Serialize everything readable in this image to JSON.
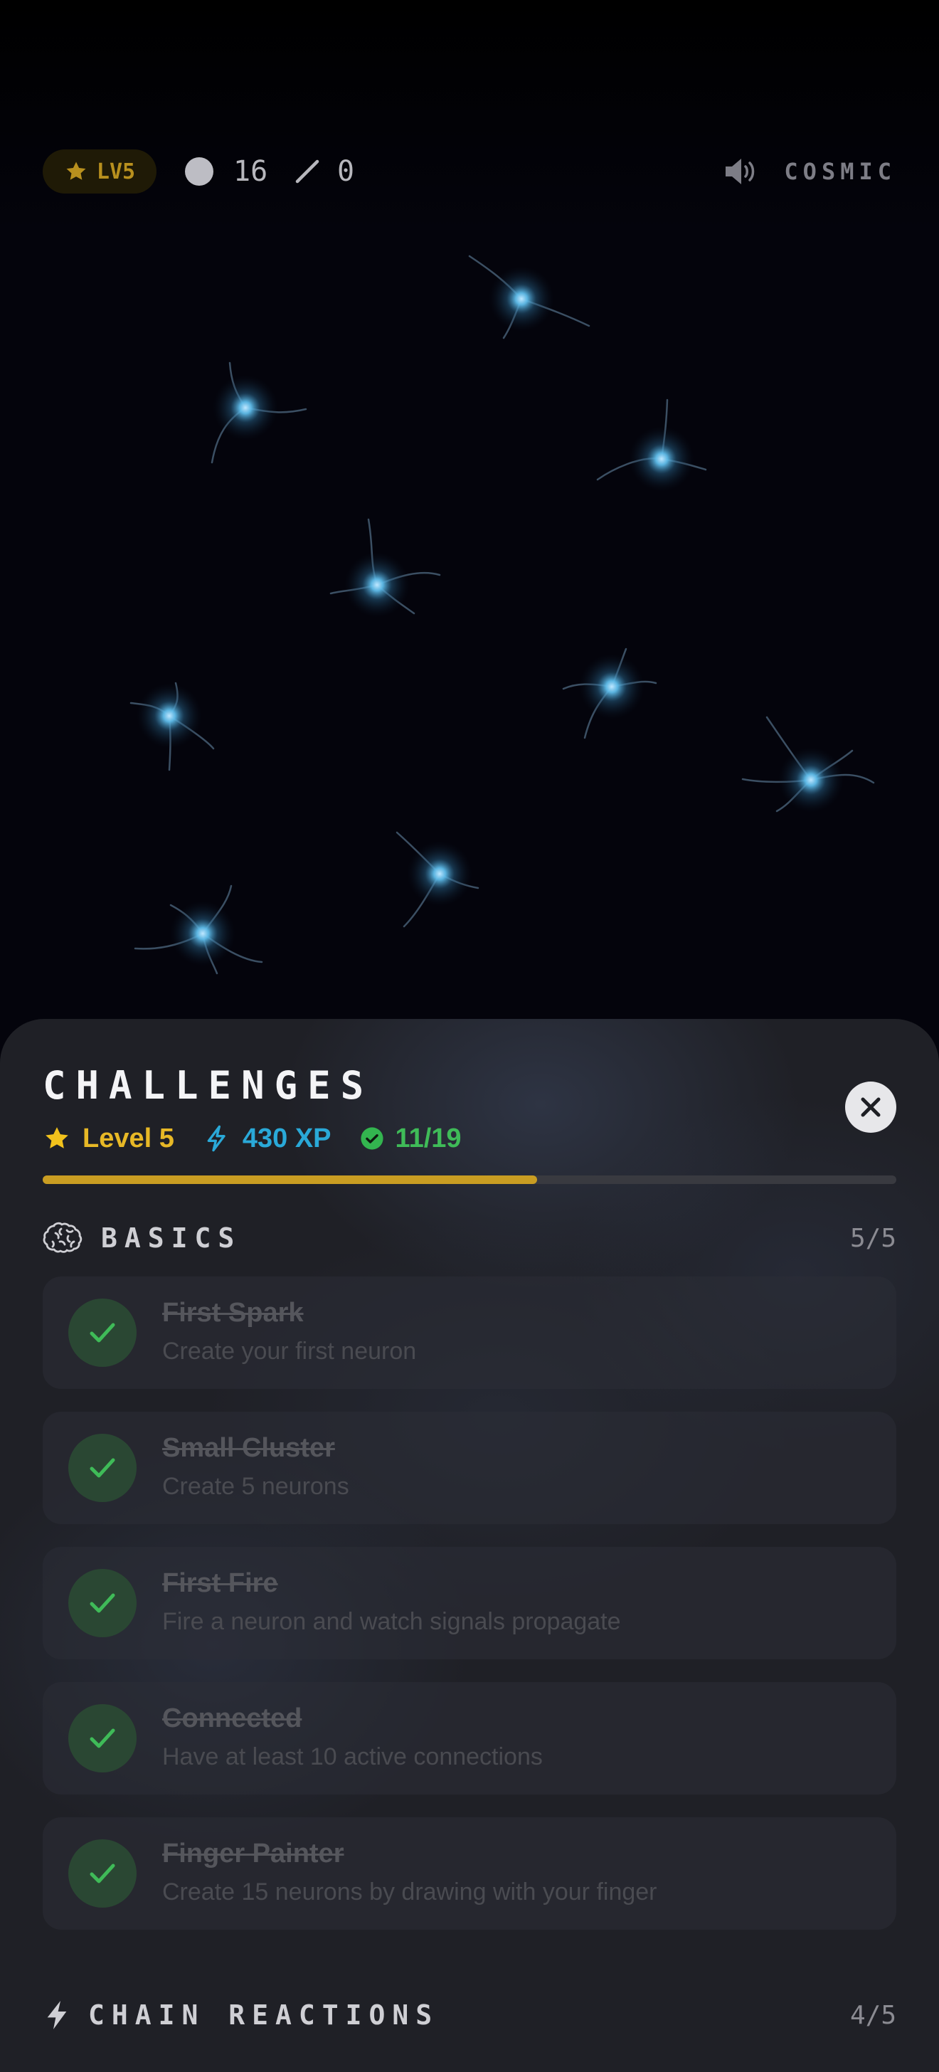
{
  "hud": {
    "level_badge": "LV5",
    "neuron_count": "16",
    "connection_count": "0",
    "theme_label": "COSMIC",
    "icons": [
      "star-icon",
      "neuron-dot-icon",
      "connection-slash-icon",
      "speaker-icon"
    ]
  },
  "challenges": {
    "title": "CHALLENGES",
    "level_text": "Level 5",
    "xp_text": "430 XP",
    "progress_text": "11/19",
    "progress_fraction": 0.579,
    "sections": [
      {
        "title": "BASICS",
        "count": "5/5",
        "icon": "brain-icon",
        "items": [
          {
            "title": "First Spark",
            "description": "Create your first neuron",
            "completed": true
          },
          {
            "title": "Small Cluster",
            "description": "Create 5 neurons",
            "completed": true
          },
          {
            "title": "First Fire",
            "description": "Fire a neuron and watch signals propagate",
            "completed": true
          },
          {
            "title": "Connected",
            "description": "Have at least 10 active connections",
            "completed": true
          },
          {
            "title": "Finger Painter",
            "description": "Create 15 neurons by drawing with your finger",
            "completed": true
          }
        ]
      },
      {
        "title": "CHAIN REACTIONS",
        "count": "4/5",
        "icon": "bolt-icon",
        "items": []
      }
    ]
  },
  "colors": {
    "level_gold": "#e7b826",
    "xp_blue": "#2aa9d8",
    "complete_green": "#3fbb58",
    "neuron_glow": "#4fb3e6",
    "progress_fill": "#c99d22"
  }
}
